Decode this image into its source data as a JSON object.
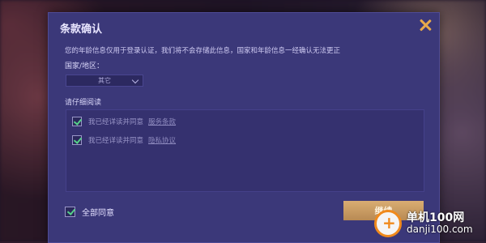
{
  "dialog": {
    "title": "条款确认",
    "notice": "您的年龄信息仅用于登录认证，我们将不会存储此信息，国家和年龄信息一经确认无法更正",
    "country_label": "国家/地区：",
    "country_value": "其它",
    "read_label": "请仔细阅读",
    "agreements": [
      {
        "text": "我已经详读并同意",
        "link": "服务条款",
        "checked": true
      },
      {
        "text": "我已经详读并同意",
        "link": "隐私协议",
        "checked": true
      }
    ],
    "agree_all_label": "全部同意",
    "agree_all_checked": true,
    "continue_label": "继续"
  },
  "watermark": {
    "cn": "单机100网",
    "en": "danji100.com"
  },
  "colors": {
    "dialog_bg": "#3b3879",
    "accent": "#e8a94b",
    "check": "#56d18a",
    "button": "#c9995f"
  }
}
